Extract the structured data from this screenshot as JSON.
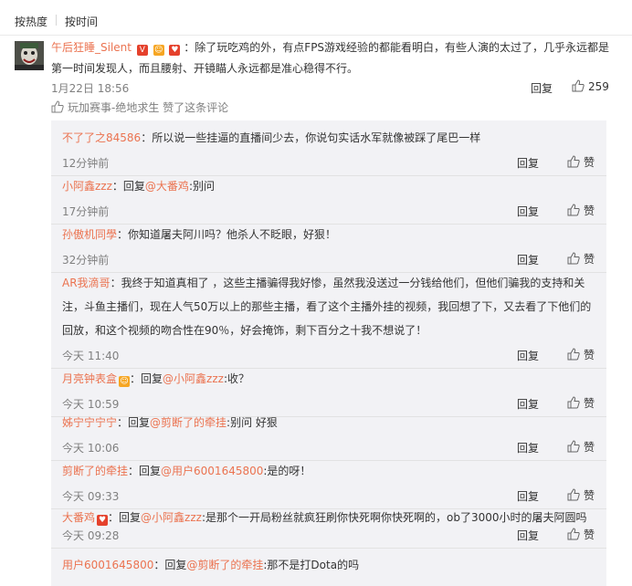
{
  "sort": {
    "hot": "按热度",
    "time": "按时间"
  },
  "main": {
    "username": "午后狂睡_Silent",
    "text": "：除了玩吃鸡的外，有点FPS游戏经验的都能看明白，有些人演的太过了，几乎永远都是第一时间发现人，而且腰射、开镜瞄人永远都是准心稳得不行。",
    "time": "1月22日 18:56",
    "reply_label": "回复",
    "like_count": "259",
    "liked_by_user": "玩加赛事-绝地求生",
    "liked_by_suffix": " 赞了这条评论"
  },
  "replies": [
    {
      "user": "不了了之84586",
      "text": "：所以说一些挂逼的直播间少去，你说句实话水军就像被踩了尾巴一样",
      "time": "12分钟前",
      "reply_label": "回复",
      "like_label": "赞"
    },
    {
      "user": "小阿鑫zzz",
      "pre": "：回复",
      "at": "@大番鸡",
      "text": ":别问",
      "time": "17分钟前",
      "reply_label": "回复",
      "like_label": "赞"
    },
    {
      "user": "孙傲机同學",
      "text": "：你知道屠夫阿川吗？他杀人不眨眼，好狠！",
      "time": "32分钟前",
      "reply_label": "回复",
      "like_label": "赞"
    },
    {
      "user": "AR我滴哥",
      "text": "：我终于知道真相了 ，这些主播骗得我好惨，虽然我没送过一分钱给他们，但他们骗我的支持和关注，斗鱼主播们，现在人气50万以上的那些主播，看了这个主播外挂的视频，我回想了下，又去看了下他们的回放，和这个视频的吻合性在90％，好会掩饰，剩下百分之十我不想说了！",
      "time": "今天 11:40",
      "reply_label": "回复",
      "like_label": "赞"
    },
    {
      "user": "月亮钟表盒",
      "pre": "：回复",
      "at": "@小阿鑫zzz",
      "text": ":收？",
      "time": "今天 10:59",
      "reply_label": "回复",
      "like_label": "赞"
    },
    {
      "user": "姊宁宁宁宁",
      "pre": "：回复",
      "at": "@剪断了的牵挂",
      "text": ":别问 好狠",
      "time": "今天 10:06",
      "reply_label": "回复",
      "like_label": "赞"
    },
    {
      "user": "剪断了的牵挂",
      "pre": "：回复",
      "at": "@用户6001645800",
      "text": ":是的呀！",
      "time": "今天 09:33",
      "reply_label": "回复",
      "like_label": "赞"
    },
    {
      "user": "大番鸡",
      "pre": "：回复",
      "at": "@小阿鑫zzz",
      "text": ":是那个一开局粉丝就疯狂刷你快死啊你快死啊的，ob了3000小时的屠夫阿圆吗",
      "time": "今天 09:28",
      "reply_label": "回复",
      "like_label": "赞"
    },
    {
      "user": "用户6001645800",
      "pre": "：回复",
      "at": "@剪断了的牵挂",
      "text": ":那不是打Dota的吗",
      "time": "",
      "reply_label": "",
      "like_label": ""
    }
  ],
  "colors": {
    "link": "#eb7350",
    "muted": "#808080",
    "reply_bg": "#f2f2f5"
  }
}
